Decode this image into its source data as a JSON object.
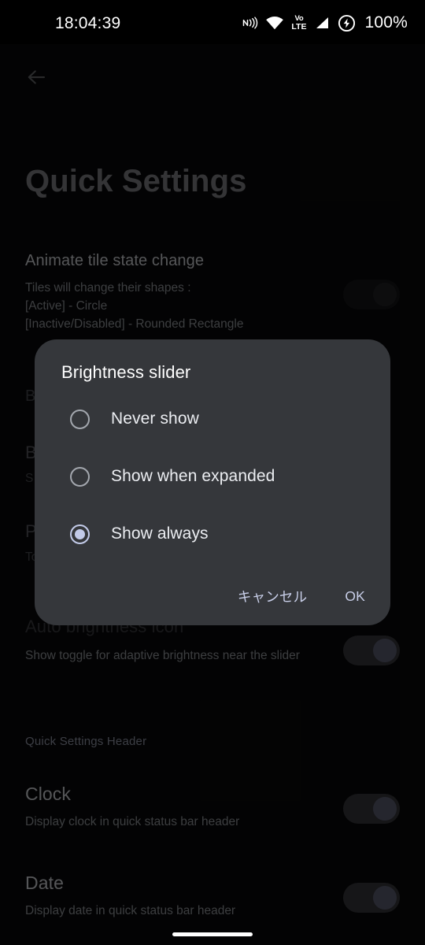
{
  "status_bar": {
    "time": "18:04:39",
    "battery_percent": "100%",
    "icons": [
      {
        "name": "nfc-icon",
        "label": "NFC"
      },
      {
        "name": "wifi-icon",
        "label": "Wi-Fi"
      },
      {
        "name": "volte-icon",
        "label_top": "VoLTE",
        "line1": "Vo",
        "line2": "LTE"
      },
      {
        "name": "cellular-signal-icon",
        "label": "Signal"
      },
      {
        "name": "battery-charging-icon",
        "label": "Charging"
      }
    ]
  },
  "navigation": {
    "back_label": "Back"
  },
  "page": {
    "title": "Quick Settings"
  },
  "settings": [
    {
      "name": "animate-tile-state-change",
      "title": "Animate tile state change",
      "subtitle": "Tiles will change their shapes :\n[Active] - Circle\n[Inactive/Disabled] - Rounded Rectangle",
      "toggle": "on"
    },
    {
      "name": "brightness-slider-hidden-1",
      "title": "B",
      "subtitle": "",
      "toggle": "none"
    },
    {
      "name": "brightness-slider-hidden-2",
      "title": "B",
      "subtitle": "S",
      "toggle": "none"
    },
    {
      "name": "brightness-hidden-3",
      "title": "P",
      "subtitle": "To",
      "toggle": "none"
    },
    {
      "name": "auto-brightness-icon",
      "title": "Auto brightness icon",
      "subtitle": "Show toggle for adaptive brightness near the slider",
      "toggle": "on"
    }
  ],
  "section_header": {
    "quick_settings_header": "Quick Settings Header"
  },
  "header_settings": [
    {
      "name": "clock",
      "title": "Clock",
      "subtitle": "Display clock in quick status bar header",
      "toggle": "on"
    },
    {
      "name": "date",
      "title": "Date",
      "subtitle": "Display date in quick status bar header",
      "toggle": "on"
    }
  ],
  "dialog": {
    "title": "Brightness slider",
    "options": [
      {
        "label": "Never show",
        "selected": false
      },
      {
        "label": "Show when expanded",
        "selected": false
      },
      {
        "label": "Show always",
        "selected": true
      }
    ],
    "cancel_label": "キャンセル",
    "ok_label": "OK"
  },
  "colors": {
    "background": "#0a0a0b",
    "dialog_background": "#35373b",
    "accent": "#c3cbe9",
    "toggle_track": "#3b3c40",
    "toggle_thumb": "#62657a",
    "primary_text": "#dfe1e6",
    "secondary_text": "#9fa2a8"
  }
}
